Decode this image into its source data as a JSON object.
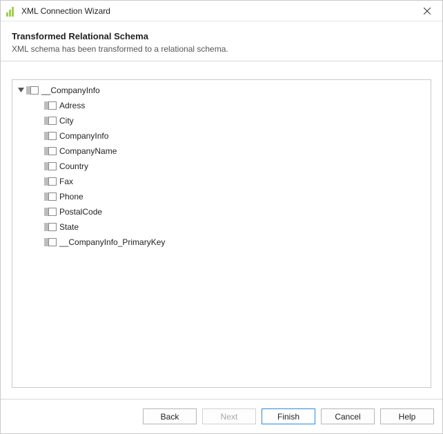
{
  "window": {
    "title": "XML Connection Wizard"
  },
  "header": {
    "heading": "Transformed Relational Schema",
    "subheading": "XML schema has been transformed to a relational schema."
  },
  "tree": {
    "root": {
      "label": "__CompanyInfo",
      "expanded": true,
      "children": [
        {
          "label": "Adress"
        },
        {
          "label": "City"
        },
        {
          "label": "CompanyInfo"
        },
        {
          "label": "CompanyName"
        },
        {
          "label": "Country"
        },
        {
          "label": "Fax"
        },
        {
          "label": "Phone"
        },
        {
          "label": "PostalCode"
        },
        {
          "label": "State"
        },
        {
          "label": "__CompanyInfo_PrimaryKey"
        }
      ]
    }
  },
  "footer": {
    "back": "Back",
    "next": "Next",
    "finish": "Finish",
    "cancel": "Cancel",
    "help": "Help",
    "next_enabled": false
  }
}
